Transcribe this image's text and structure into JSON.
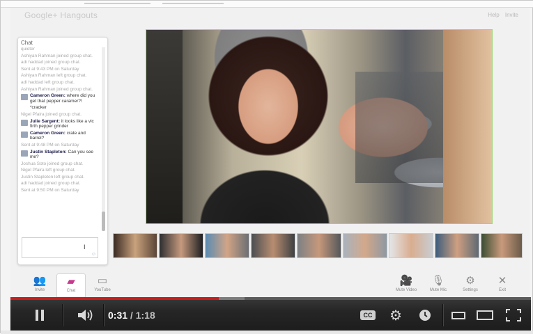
{
  "hangout": {
    "logo_text": "Google+ Hangouts",
    "top_links": [
      "Help",
      "Invite"
    ],
    "chat": {
      "title": "Chat",
      "messages": [
        {
          "type": "sys",
          "text": "quieter"
        },
        {
          "type": "sys",
          "text": "Ashiyan Rahman joined group chat."
        },
        {
          "type": "sys",
          "text": "adi haddad joined group chat."
        },
        {
          "type": "sys",
          "text": "Sent at 9:43 PM on Saturday"
        },
        {
          "type": "sys",
          "text": "Ashiyan Rahman left group chat."
        },
        {
          "type": "sys",
          "text": "adi haddad left group chat."
        },
        {
          "type": "sys",
          "text": "Ashiyan Rahman joined group chat."
        },
        {
          "type": "user",
          "name": "Cameron Green:",
          "text": "where did you get that pepper caramer?!"
        },
        {
          "type": "plain",
          "text": "*cracker"
        },
        {
          "type": "sys",
          "text": "Nigel Pfaira joined group chat."
        },
        {
          "type": "user",
          "name": "Julie Sargent:",
          "text": "it looks like a vic firth pepper grinder"
        },
        {
          "type": "user",
          "name": "Cameron Green:",
          "text": "crate and barrel?"
        },
        {
          "type": "sys",
          "text": "Sent at 9:48 PM on Saturday"
        },
        {
          "type": "user",
          "name": "Justin Stapleton:",
          "text": "Can you see me?"
        },
        {
          "type": "sys",
          "text": "Joshua Soto joined group chat."
        },
        {
          "type": "sys",
          "text": "Nigel Pfaira left group chat."
        },
        {
          "type": "sys",
          "text": "Justin Stapleton left group chat."
        },
        {
          "type": "sys",
          "text": "adi haddad joined group chat."
        },
        {
          "type": "sys",
          "text": "Sent at 9:50 PM on Saturday"
        }
      ],
      "input_value": "",
      "cursor_glyph": "I"
    },
    "toolbar": {
      "left": [
        {
          "label": "Invite",
          "icon": "people-icon",
          "glyph": "👥",
          "active": false
        },
        {
          "label": "Chat",
          "icon": "chat-icon",
          "glyph": "▰",
          "active": true
        },
        {
          "label": "YouTube",
          "icon": "youtube-icon",
          "glyph": "▭",
          "active": false
        }
      ],
      "right": [
        {
          "label": "Mute Video",
          "icon": "camera-icon",
          "glyph": "🎥"
        },
        {
          "label": "Mute Mic",
          "icon": "mic-icon",
          "glyph": "🎙"
        },
        {
          "label": "Settings",
          "icon": "gear-icon",
          "glyph": "⚙"
        },
        {
          "label": "Exit",
          "icon": "close-icon",
          "glyph": "✕"
        }
      ]
    }
  },
  "player": {
    "time_current": "0:31",
    "time_separator": " / ",
    "time_total": "1:18",
    "progress_fraction": 0.4,
    "buffered_fraction": 0.45,
    "cc_label": "CC",
    "colors": {
      "progress": "#cc1b1b",
      "bar": "#262626"
    }
  }
}
